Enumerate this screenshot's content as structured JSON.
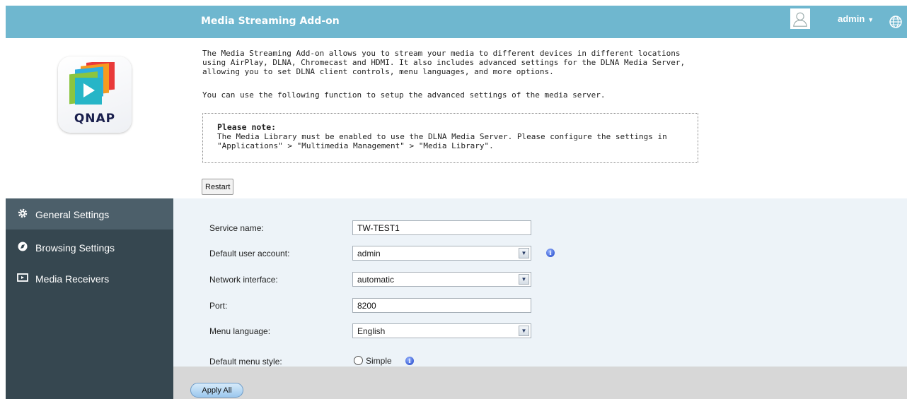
{
  "header": {
    "title": "Media Streaming Add-on",
    "user": "admin",
    "user_caret": "▼"
  },
  "logo": {
    "brand": "QNAP"
  },
  "intro": {
    "paragraph1": "The Media Streaming Add-on allows you to stream your media to different devices in different locations using AirPlay, DLNA, Chromecast and HDMI. It also includes advanced settings for the DLNA Media Server, allowing you to set DLNA client controls, menu languages, and more options.",
    "paragraph2": "You can use the following function to setup the advanced settings of the media server."
  },
  "note": {
    "heading": "Please note:",
    "line1": "The Media Library must be enabled to use the DLNA Media Server. Please configure the settings in",
    "line2": "\"Applications\" > \"Multimedia Management\" > \"Media Library\"."
  },
  "restart_label": "Restart",
  "sidebar": {
    "items": [
      {
        "label": "General Settings",
        "icon": "gear-icon",
        "active": true
      },
      {
        "label": "Browsing Settings",
        "icon": "browse-icon",
        "active": false
      },
      {
        "label": "Media Receivers",
        "icon": "screen-icon",
        "active": false
      }
    ]
  },
  "form": {
    "service_name": {
      "label": "Service name:",
      "value": "TW-TEST1"
    },
    "default_user": {
      "label": "Default user account:",
      "value": "admin"
    },
    "network_interface": {
      "label": "Network interface:",
      "value": "automatic"
    },
    "port": {
      "label": "Port:",
      "value": "8200"
    },
    "menu_language": {
      "label": "Menu language:",
      "value": "English"
    },
    "menu_style": {
      "label": "Default menu style:",
      "option": "Simple"
    }
  },
  "apply_label": "Apply All",
  "colors": {
    "header_bg": "#6fb7cf",
    "sidebar_bg": "#364750",
    "sidebar_active": "#4c5f6a",
    "panel_bg": "#edf3f8",
    "footer_bg": "#d7d7d7"
  }
}
